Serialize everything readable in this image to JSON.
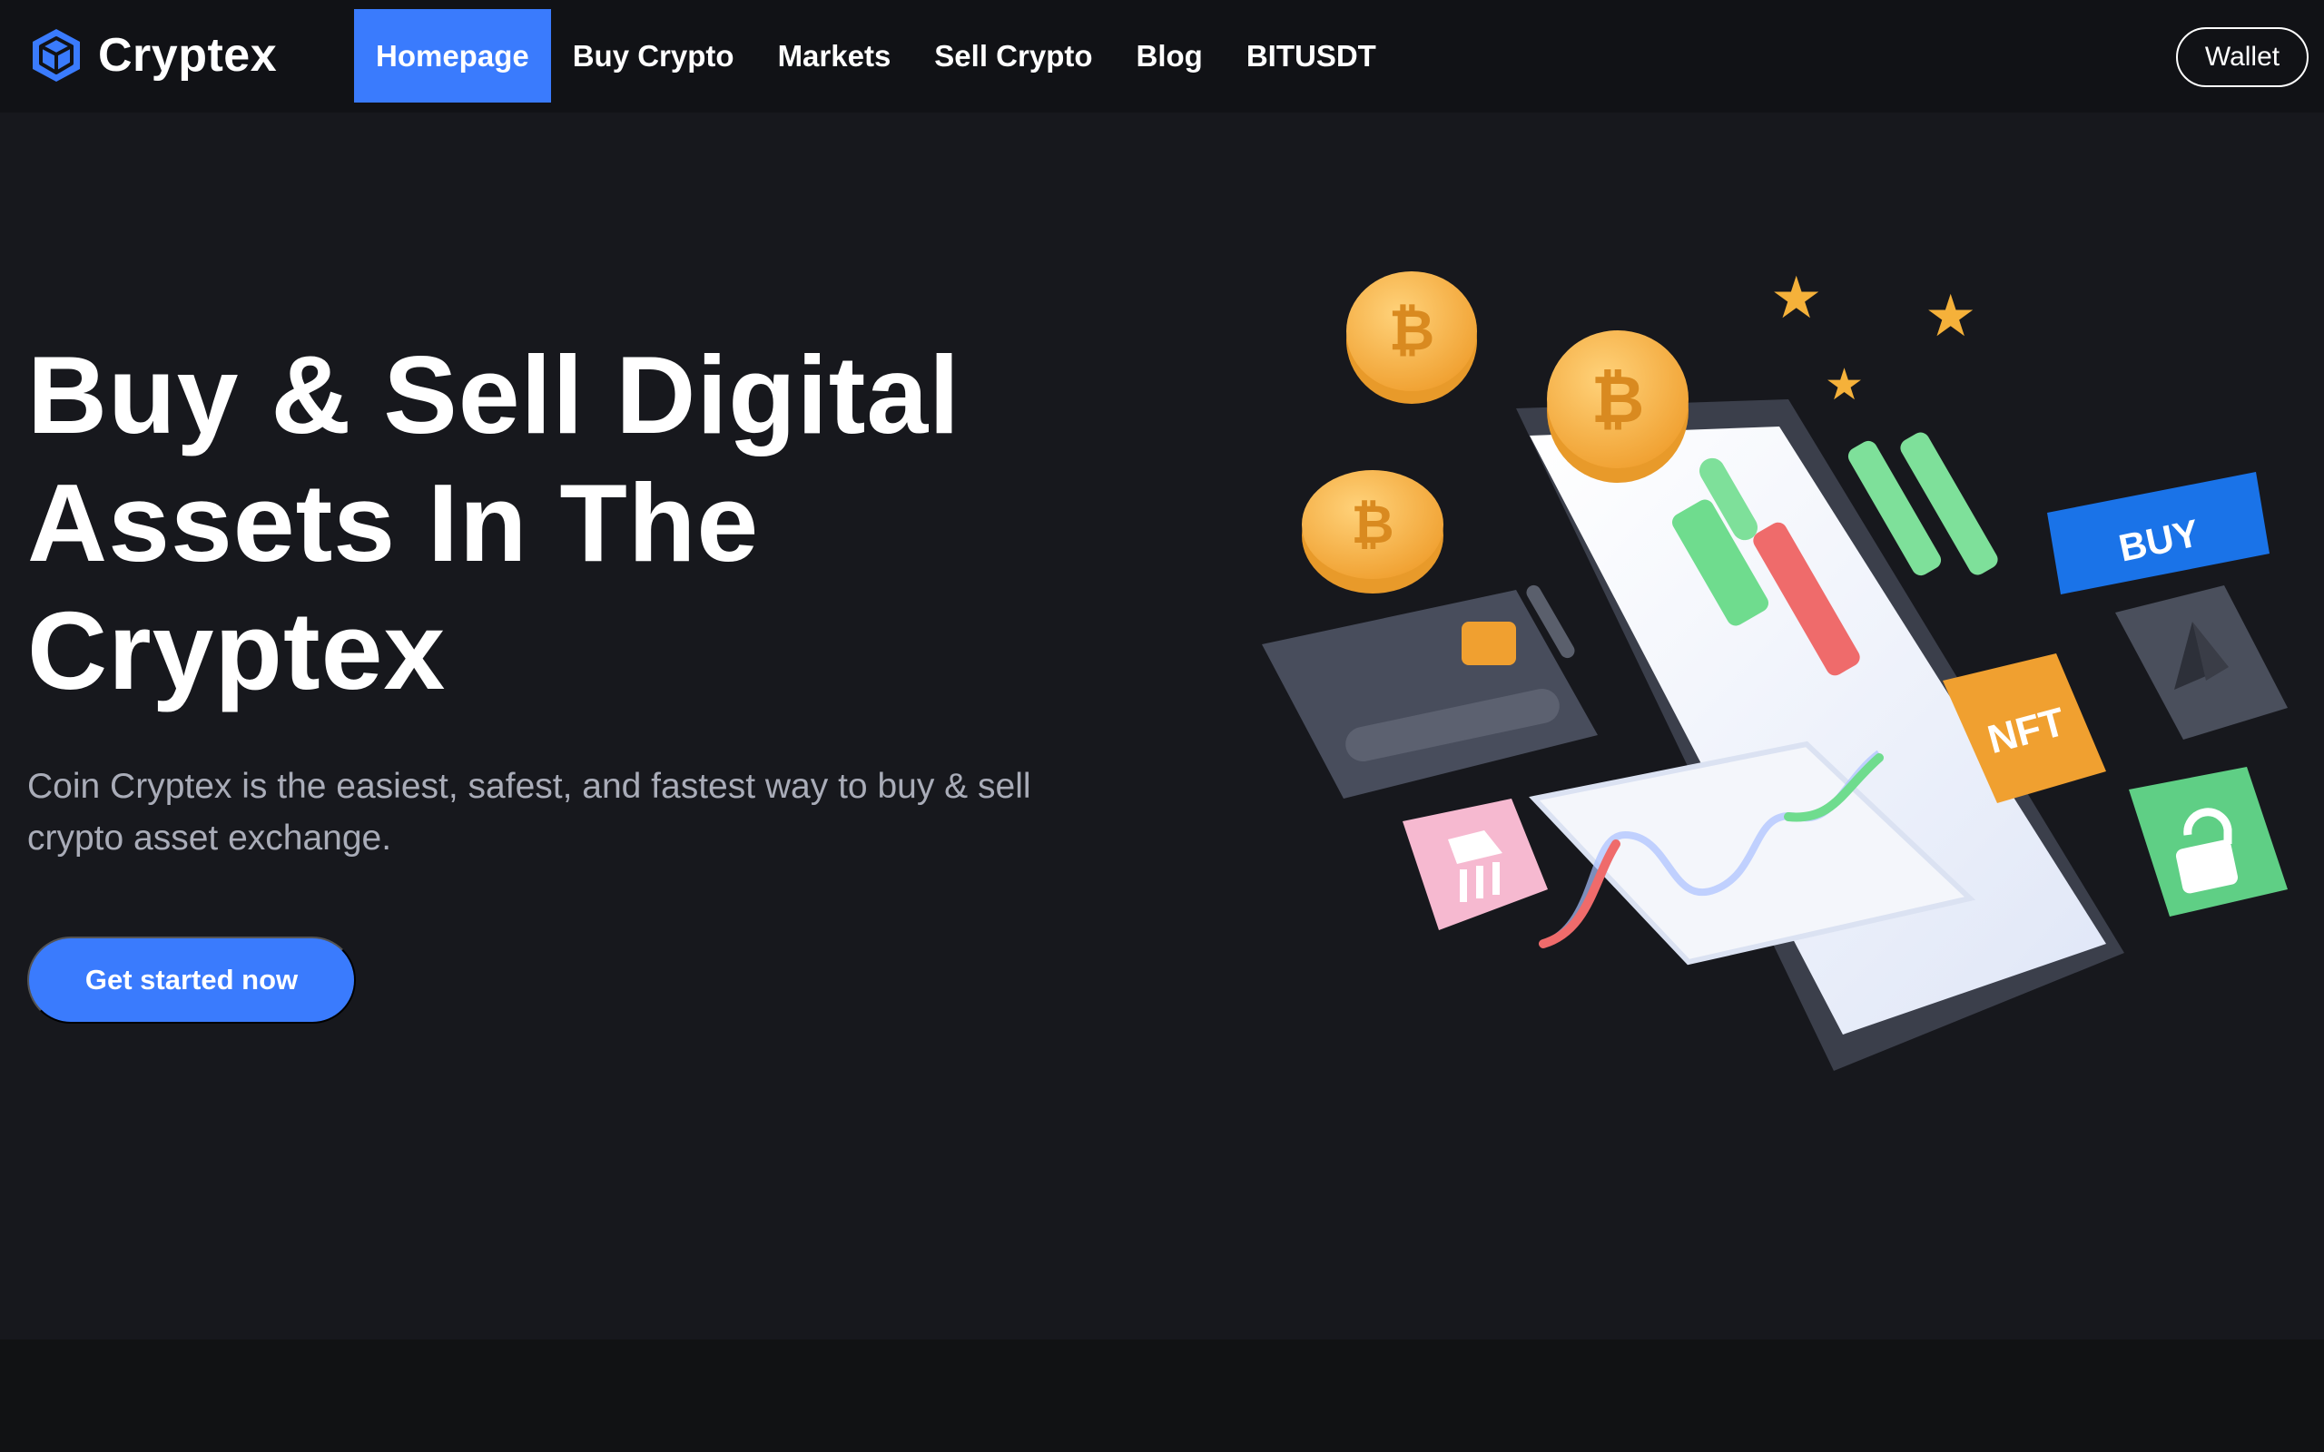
{
  "brand": {
    "name": "Cryptex",
    "logo_icon": "cube-icon",
    "accent": "#3a7bfd"
  },
  "nav": {
    "items": [
      {
        "label": "Homepage",
        "active": true
      },
      {
        "label": "Buy Crypto",
        "active": false
      },
      {
        "label": "Markets",
        "active": false
      },
      {
        "label": "Sell Crypto",
        "active": false
      },
      {
        "label": "Blog",
        "active": false
      },
      {
        "label": "BITUSDT",
        "active": false
      }
    ],
    "wallet_label": "Wallet"
  },
  "hero": {
    "title": "Buy & Sell Digital Assets In The Cryptex",
    "description": "Coin Cryptex is the easiest, safest, and fastest way to buy & sell crypto asset exchange.",
    "cta_label": "Get started now"
  },
  "illustration": {
    "buy_tile": "BUY",
    "nft_tile": "NFT",
    "icons": [
      "bitcoin-coin-icon",
      "star-icon",
      "ethereum-icon",
      "lock-icon",
      "bank-icon",
      "credit-card-icon",
      "smartphone-icon"
    ]
  },
  "colors": {
    "background": "#17181d",
    "topbar": "#111216",
    "text_muted": "#a9acb8"
  }
}
